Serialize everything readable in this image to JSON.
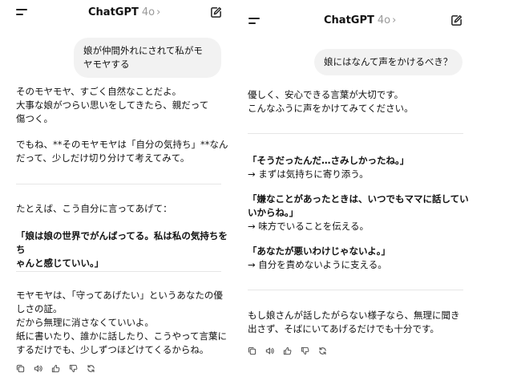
{
  "left": {
    "header": {
      "title": "ChatGPT",
      "model": "4o",
      "chevron": "›"
    },
    "user_message": "娘が仲間外れにされて私がモヤモヤする",
    "blocks": [
      "そのモヤモヤ、すごく自然なことだよ。\n大事な娘がつらい思いをしてきたら、親だって\n傷つく。",
      "でもね、**そのモヤモヤは「自分の気持ち」**なん\nだって、少しだけ切り分けて考えてみて。",
      "たとえば、こう自分に言ってあげて：",
      "「娘は娘の世界でがんばってる。私は私の気持ちをち\nゃんと感じていい。」",
      "モヤモヤは、「守ってあげたい」というあなたの優\nしさの証。\nだから無理に消さなくていいよ。\n紙に書いたり、誰かに話したり、こうやって言葉に\nするだけでも、少しずつほどけてくるからね。"
    ]
  },
  "right": {
    "header": {
      "title": "ChatGPT",
      "model": "4o",
      "chevron": "›"
    },
    "user_message": "娘にはなんて声をかけるべき？",
    "intro": "優しく、安心できる言葉が大切です。\nこんなふうに声をかけてみてください。",
    "phrases": [
      {
        "quote": "「そうだったんだ…さみしかったね。」",
        "note": "→ まずは気持ちに寄り添う。"
      },
      {
        "quote": "「嫌なことがあったときは、いつでもママに話してい\nいからね。」",
        "note": "→ 味方でいることを伝える。"
      },
      {
        "quote": "「あなたが悪いわけじゃないよ。」",
        "note": "→ 自分を責めないように支える。"
      }
    ],
    "closing": "もし娘さんが話したがらない様子なら、無理に聞き\n出さず、そばにいてあげるだけでも十分です。"
  },
  "icons": {
    "menu": "menu-icon",
    "edit": "compose-icon",
    "actions": [
      "copy-icon",
      "speaker-icon",
      "thumbs-up-icon",
      "thumbs-down-icon",
      "regenerate-icon"
    ]
  }
}
